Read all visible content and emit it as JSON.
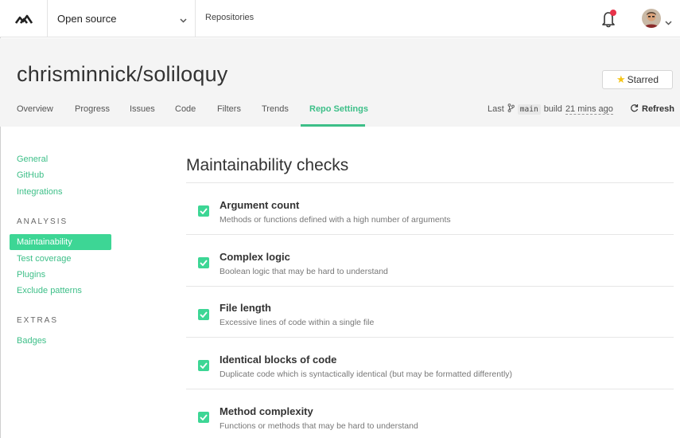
{
  "topbar": {
    "org_label": "Open source",
    "repos_label": "Repositories"
  },
  "repo": {
    "title": "chrisminnick/soliloquy",
    "star_label": "Starred",
    "tabs": [
      "Overview",
      "Progress",
      "Issues",
      "Code",
      "Filters",
      "Trends",
      "Repo Settings"
    ],
    "active_tab": "Repo Settings",
    "build": {
      "prefix": "Last",
      "branch": "main",
      "mid": "build",
      "ago": "21 mins ago"
    },
    "refresh_label": "Refresh"
  },
  "sidebar": {
    "top_links": [
      "General",
      "GitHub",
      "Integrations"
    ],
    "analysis_heading": "ANALYSIS",
    "analysis_active": "Maintainability",
    "analysis_links": [
      "Test coverage",
      "Plugins",
      "Exclude patterns"
    ],
    "extras_heading": "EXTRAS",
    "extras_links": [
      "Badges"
    ]
  },
  "main": {
    "title": "Maintainability checks",
    "checks": [
      {
        "name": "Argument count",
        "description": "Methods or functions defined with a high number of arguments",
        "checked": true
      },
      {
        "name": "Complex logic",
        "description": "Boolean logic that may be hard to understand",
        "checked": true
      },
      {
        "name": "File length",
        "description": "Excessive lines of code within a single file",
        "checked": true
      },
      {
        "name": "Identical blocks of code",
        "description": "Duplicate code which is syntactically identical (but may be formatted differently)",
        "checked": true
      },
      {
        "name": "Method complexity",
        "description": "Functions or methods that may be hard to understand",
        "checked": true
      }
    ]
  },
  "colors": {
    "accent": "#3dbf88",
    "accent_fill": "#3dd695",
    "notification_dot": "#e8334a",
    "star": "#f5c518"
  },
  "icons": [
    "logo-icon",
    "chevron-down-icon",
    "bell-icon",
    "avatar",
    "star-icon",
    "branch-icon",
    "refresh-icon",
    "checkmark-icon"
  ]
}
